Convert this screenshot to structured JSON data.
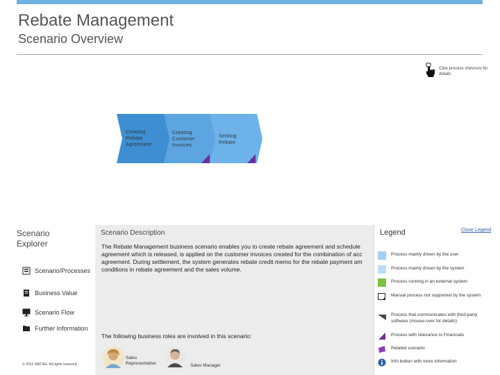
{
  "header": {
    "title": "Rebate Management",
    "subtitle": "Scenario Overview"
  },
  "hint": {
    "text": "Click process chevrons for details"
  },
  "chevrons": [
    {
      "label_lines": [
        "Creating",
        "Rebate",
        "Agreement"
      ],
      "color": "#3d8fd1"
    },
    {
      "label_lines": [
        "Creating",
        "Customer",
        "Invoices"
      ],
      "color": "#5ca5e0"
    },
    {
      "label_lines": [
        "Settling",
        "Rebate"
      ],
      "color": "#6db3ea"
    }
  ],
  "explorer": {
    "title_line1": "Scenario",
    "title_line2": "Explorer",
    "panels": [
      {
        "label": "Scenario/Processes",
        "active": true
      },
      {
        "label": "Business Value"
      },
      {
        "label": "Scenario Flow"
      },
      {
        "label": "Further Information"
      }
    ],
    "copyright": "© 2012 SAP AG. All rights reserved."
  },
  "description": {
    "title": "Scenario Description",
    "lines": [
      "The Rebate Management business scenario enables you to create rebate agreement and schedule",
      "agreement which is released, is applied on the customer invoices created for the combination of acc",
      "agreement. During settlement, the system generates rebate credit memo for the rebate payment am",
      "conditions in rebate agreement and the sales volume."
    ],
    "roles_intro": "The following business roles are involved in this scenario:",
    "roles": [
      {
        "line1": "Sales",
        "line2": "Representative"
      },
      {
        "line1": "Sales Manager",
        "line2": ""
      }
    ]
  },
  "legend": {
    "title": "Legend",
    "close_label": "Close Legend",
    "items": [
      {
        "text": "Process mainly driven by the user",
        "mark": "light-blue-square",
        "color": "#9fd0f5"
      },
      {
        "text": "Process mainly driven by the system",
        "mark": "light-blue-square",
        "color": "#b8dcf5"
      },
      {
        "text": "Process running in an external system",
        "mark": "green-square",
        "color": "#7dc242"
      },
      {
        "text": "Manual process not supported by the system",
        "mark": "manual-square"
      },
      {
        "text": "Process that communicates with third-party software (mouse-over for details)",
        "mark": "third-party-triangle"
      },
      {
        "text": "Process with relevance to Financials",
        "mark": "financials-triangle",
        "color": "#6b2fa0"
      },
      {
        "text": "Related scenario",
        "mark": "related-scenario-square",
        "color": "#8b3fbf"
      },
      {
        "text": "Info button with more information",
        "mark": "info-icon",
        "color": "#2d5fa5"
      }
    ]
  }
}
